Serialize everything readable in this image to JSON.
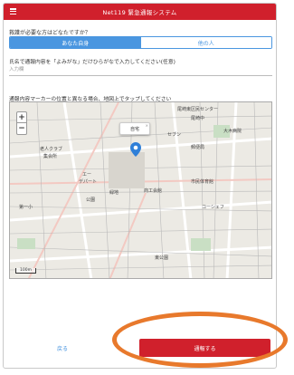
{
  "header": {
    "title": "Net119 緊急通報システム"
  },
  "question_patient": {
    "label": "救護が必要な方はどなたですか？",
    "options": [
      "あなた自身",
      "他の人"
    ],
    "selected": "あなた自身"
  },
  "question_name": {
    "label": "氏名で通報内容を「よみがな」だけひらがなで入力してください(任意)",
    "placeholder": "入力欄"
  },
  "question_map": {
    "label": "通報内容マーカーの位置と異なる場合、地図上でタップしてください"
  },
  "map": {
    "popup_label": "自宅",
    "scale_label": "100m",
    "labels": [
      "尾崎東区民センター",
      "尾崎中",
      "老人クラブ",
      "集会所",
      "エー",
      "デパート",
      "商工会館",
      "緑地",
      "公園",
      "市民体育館",
      "郵便局",
      "セブン",
      "大木病院",
      "第一小",
      "コーシェフ",
      "東公園"
    ]
  },
  "footer": {
    "back_label": "戻る",
    "report_label": "通報する"
  },
  "colors": {
    "brand_red": "#d0202c",
    "accent_blue": "#4a96e0",
    "highlight_orange": "#e8792c"
  }
}
